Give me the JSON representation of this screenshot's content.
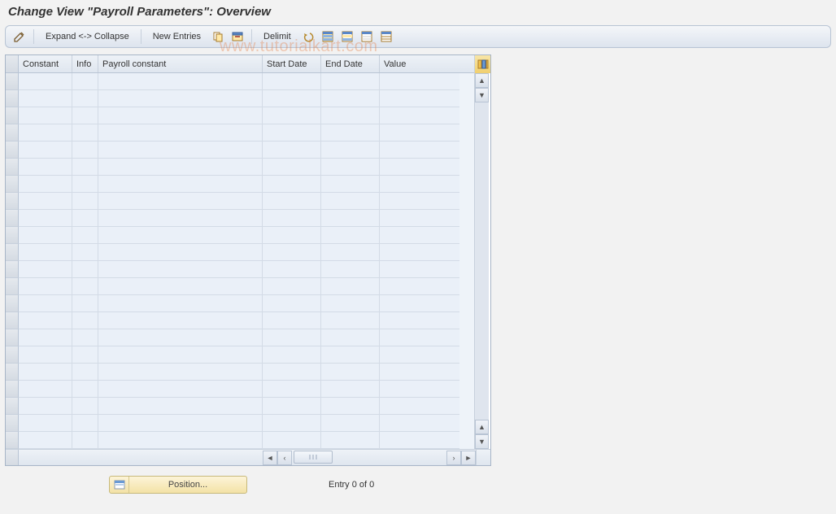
{
  "title": "Change View \"Payroll Parameters\": Overview",
  "watermark": "www.tutorialkart.com",
  "toolbar": {
    "expand_collapse": "Expand <-> Collapse",
    "new_entries": "New Entries",
    "delimit": "Delimit"
  },
  "columns": {
    "constant": "Constant",
    "info": "Info",
    "payroll_constant": "Payroll constant",
    "start_date": "Start Date",
    "end_date": "End Date",
    "value": "Value"
  },
  "footer": {
    "position_label": "Position...",
    "entry_text": "Entry 0 of 0"
  },
  "icons": {
    "pencil": "pencil-icon",
    "copy": "copy-icon",
    "delete": "delete-icon",
    "undo": "undo-icon",
    "select_all": "select-all-icon",
    "select_block": "select-block-icon",
    "deselect": "deselect-icon",
    "config": "config-icon"
  }
}
